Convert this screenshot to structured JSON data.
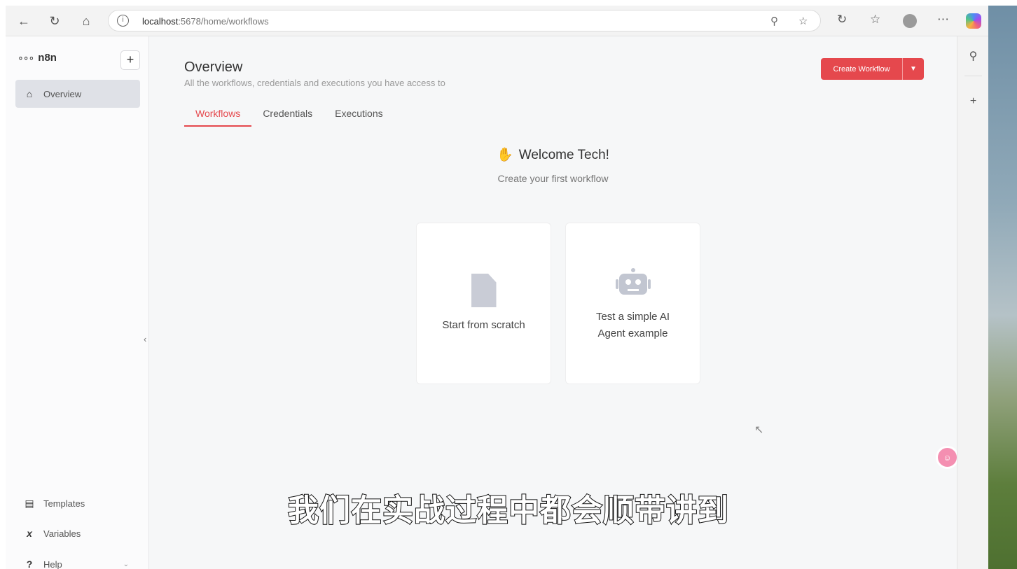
{
  "browser": {
    "url_host": "localhost",
    "url_path": ":5678/home/workflows",
    "icons": [
      "back-icon",
      "refresh-icon",
      "home-icon",
      "info-icon",
      "key-icon",
      "star-icon",
      "extension-icon",
      "favorites-icon",
      "profile-icon",
      "more-icon",
      "copilot-icon"
    ]
  },
  "sidebar": {
    "logo_text": "n8n",
    "items": [
      {
        "label": "Overview",
        "icon": "home-icon",
        "active": true
      },
      {
        "label": "Templates",
        "icon": "templates-icon"
      },
      {
        "label": "Variables",
        "icon": "variables-icon"
      },
      {
        "label": "Help",
        "icon": "help-icon"
      }
    ]
  },
  "main": {
    "title": "Overview",
    "subtitle": "All the workflows, credentials and executions you have access to",
    "create_button": "Create Workflow",
    "tabs": [
      {
        "label": "Workflows",
        "active": true
      },
      {
        "label": "Credentials"
      },
      {
        "label": "Executions"
      }
    ],
    "welcome": "Welcome Tech!",
    "welcome_sub": "Create your first workflow",
    "cards": [
      {
        "label": "Start from scratch",
        "icon": "file-icon"
      },
      {
        "label_line1": "Test a simple AI",
        "label_line2": "Agent example",
        "icon": "robot-icon"
      }
    ]
  },
  "caption": "我们在实战过程中都会顺带讲到",
  "colors": {
    "accent": "#e5484d",
    "sidebar_active": "#dfe1e7",
    "page_bg": "#f6f7f8"
  }
}
